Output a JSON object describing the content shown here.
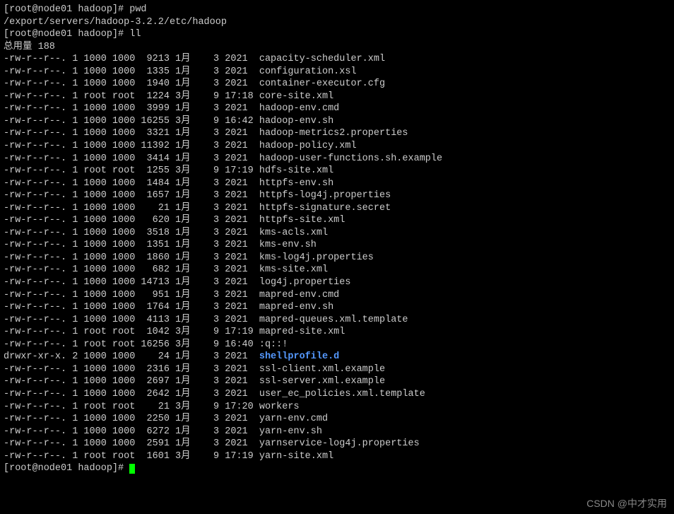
{
  "prompt1": "[root@node01 hadoop]# ",
  "cmd1": "pwd",
  "pwd_output": "/export/servers/hadoop-3.2.2/etc/hadoop",
  "prompt2": "[root@node01 hadoop]# ",
  "cmd2": "ll",
  "total_line": "总用量 188",
  "files": [
    {
      "perm": "-rw-r--r--.",
      "links": "1",
      "owner": "1000",
      "group": "1000",
      "size": "9213",
      "month": "1月",
      "day": "3",
      "time": "2021",
      "name": "capacity-scheduler.xml",
      "dir": false
    },
    {
      "perm": "-rw-r--r--.",
      "links": "1",
      "owner": "1000",
      "group": "1000",
      "size": "1335",
      "month": "1月",
      "day": "3",
      "time": "2021",
      "name": "configuration.xsl",
      "dir": false
    },
    {
      "perm": "-rw-r--r--.",
      "links": "1",
      "owner": "1000",
      "group": "1000",
      "size": "1940",
      "month": "1月",
      "day": "3",
      "time": "2021",
      "name": "container-executor.cfg",
      "dir": false
    },
    {
      "perm": "-rw-r--r--.",
      "links": "1",
      "owner": "root",
      "group": "root",
      "size": "1224",
      "month": "3月",
      "day": "9",
      "time": "17:18",
      "name": "core-site.xml",
      "dir": false
    },
    {
      "perm": "-rw-r--r--.",
      "links": "1",
      "owner": "1000",
      "group": "1000",
      "size": "3999",
      "month": "1月",
      "day": "3",
      "time": "2021",
      "name": "hadoop-env.cmd",
      "dir": false
    },
    {
      "perm": "-rw-r--r--.",
      "links": "1",
      "owner": "1000",
      "group": "1000",
      "size": "16255",
      "month": "3月",
      "day": "9",
      "time": "16:42",
      "name": "hadoop-env.sh",
      "dir": false
    },
    {
      "perm": "-rw-r--r--.",
      "links": "1",
      "owner": "1000",
      "group": "1000",
      "size": "3321",
      "month": "1月",
      "day": "3",
      "time": "2021",
      "name": "hadoop-metrics2.properties",
      "dir": false
    },
    {
      "perm": "-rw-r--r--.",
      "links": "1",
      "owner": "1000",
      "group": "1000",
      "size": "11392",
      "month": "1月",
      "day": "3",
      "time": "2021",
      "name": "hadoop-policy.xml",
      "dir": false
    },
    {
      "perm": "-rw-r--r--.",
      "links": "1",
      "owner": "1000",
      "group": "1000",
      "size": "3414",
      "month": "1月",
      "day": "3",
      "time": "2021",
      "name": "hadoop-user-functions.sh.example",
      "dir": false
    },
    {
      "perm": "-rw-r--r--.",
      "links": "1",
      "owner": "root",
      "group": "root",
      "size": "1255",
      "month": "3月",
      "day": "9",
      "time": "17:19",
      "name": "hdfs-site.xml",
      "dir": false
    },
    {
      "perm": "-rw-r--r--.",
      "links": "1",
      "owner": "1000",
      "group": "1000",
      "size": "1484",
      "month": "1月",
      "day": "3",
      "time": "2021",
      "name": "httpfs-env.sh",
      "dir": false
    },
    {
      "perm": "-rw-r--r--.",
      "links": "1",
      "owner": "1000",
      "group": "1000",
      "size": "1657",
      "month": "1月",
      "day": "3",
      "time": "2021",
      "name": "httpfs-log4j.properties",
      "dir": false
    },
    {
      "perm": "-rw-r--r--.",
      "links": "1",
      "owner": "1000",
      "group": "1000",
      "size": "21",
      "month": "1月",
      "day": "3",
      "time": "2021",
      "name": "httpfs-signature.secret",
      "dir": false
    },
    {
      "perm": "-rw-r--r--.",
      "links": "1",
      "owner": "1000",
      "group": "1000",
      "size": "620",
      "month": "1月",
      "day": "3",
      "time": "2021",
      "name": "httpfs-site.xml",
      "dir": false
    },
    {
      "perm": "-rw-r--r--.",
      "links": "1",
      "owner": "1000",
      "group": "1000",
      "size": "3518",
      "month": "1月",
      "day": "3",
      "time": "2021",
      "name": "kms-acls.xml",
      "dir": false
    },
    {
      "perm": "-rw-r--r--.",
      "links": "1",
      "owner": "1000",
      "group": "1000",
      "size": "1351",
      "month": "1月",
      "day": "3",
      "time": "2021",
      "name": "kms-env.sh",
      "dir": false
    },
    {
      "perm": "-rw-r--r--.",
      "links": "1",
      "owner": "1000",
      "group": "1000",
      "size": "1860",
      "month": "1月",
      "day": "3",
      "time": "2021",
      "name": "kms-log4j.properties",
      "dir": false
    },
    {
      "perm": "-rw-r--r--.",
      "links": "1",
      "owner": "1000",
      "group": "1000",
      "size": "682",
      "month": "1月",
      "day": "3",
      "time": "2021",
      "name": "kms-site.xml",
      "dir": false
    },
    {
      "perm": "-rw-r--r--.",
      "links": "1",
      "owner": "1000",
      "group": "1000",
      "size": "14713",
      "month": "1月",
      "day": "3",
      "time": "2021",
      "name": "log4j.properties",
      "dir": false
    },
    {
      "perm": "-rw-r--r--.",
      "links": "1",
      "owner": "1000",
      "group": "1000",
      "size": "951",
      "month": "1月",
      "day": "3",
      "time": "2021",
      "name": "mapred-env.cmd",
      "dir": false
    },
    {
      "perm": "-rw-r--r--.",
      "links": "1",
      "owner": "1000",
      "group": "1000",
      "size": "1764",
      "month": "1月",
      "day": "3",
      "time": "2021",
      "name": "mapred-env.sh",
      "dir": false
    },
    {
      "perm": "-rw-r--r--.",
      "links": "1",
      "owner": "1000",
      "group": "1000",
      "size": "4113",
      "month": "1月",
      "day": "3",
      "time": "2021",
      "name": "mapred-queues.xml.template",
      "dir": false
    },
    {
      "perm": "-rw-r--r--.",
      "links": "1",
      "owner": "root",
      "group": "root",
      "size": "1042",
      "month": "3月",
      "day": "9",
      "time": "17:19",
      "name": "mapred-site.xml",
      "dir": false
    },
    {
      "perm": "-rw-r--r--.",
      "links": "1",
      "owner": "root",
      "group": "root",
      "size": "16256",
      "month": "3月",
      "day": "9",
      "time": "16:40",
      "name": ":q::!",
      "dir": false
    },
    {
      "perm": "drwxr-xr-x.",
      "links": "2",
      "owner": "1000",
      "group": "1000",
      "size": "24",
      "month": "1月",
      "day": "3",
      "time": "2021",
      "name": "shellprofile.d",
      "dir": true
    },
    {
      "perm": "-rw-r--r--.",
      "links": "1",
      "owner": "1000",
      "group": "1000",
      "size": "2316",
      "month": "1月",
      "day": "3",
      "time": "2021",
      "name": "ssl-client.xml.example",
      "dir": false
    },
    {
      "perm": "-rw-r--r--.",
      "links": "1",
      "owner": "1000",
      "group": "1000",
      "size": "2697",
      "month": "1月",
      "day": "3",
      "time": "2021",
      "name": "ssl-server.xml.example",
      "dir": false
    },
    {
      "perm": "-rw-r--r--.",
      "links": "1",
      "owner": "1000",
      "group": "1000",
      "size": "2642",
      "month": "1月",
      "day": "3",
      "time": "2021",
      "name": "user_ec_policies.xml.template",
      "dir": false
    },
    {
      "perm": "-rw-r--r--.",
      "links": "1",
      "owner": "root",
      "group": "root",
      "size": "21",
      "month": "3月",
      "day": "9",
      "time": "17:20",
      "name": "workers",
      "dir": false
    },
    {
      "perm": "-rw-r--r--.",
      "links": "1",
      "owner": "1000",
      "group": "1000",
      "size": "2250",
      "month": "1月",
      "day": "3",
      "time": "2021",
      "name": "yarn-env.cmd",
      "dir": false
    },
    {
      "perm": "-rw-r--r--.",
      "links": "1",
      "owner": "1000",
      "group": "1000",
      "size": "6272",
      "month": "1月",
      "day": "3",
      "time": "2021",
      "name": "yarn-env.sh",
      "dir": false
    },
    {
      "perm": "-rw-r--r--.",
      "links": "1",
      "owner": "1000",
      "group": "1000",
      "size": "2591",
      "month": "1月",
      "day": "3",
      "time": "2021",
      "name": "yarnservice-log4j.properties",
      "dir": false
    },
    {
      "perm": "-rw-r--r--.",
      "links": "1",
      "owner": "root",
      "group": "root",
      "size": "1601",
      "month": "3月",
      "day": "9",
      "time": "17:19",
      "name": "yarn-site.xml",
      "dir": false
    }
  ],
  "prompt3": "[root@node01 hadoop]# ",
  "watermark": "CSDN @中才实用"
}
